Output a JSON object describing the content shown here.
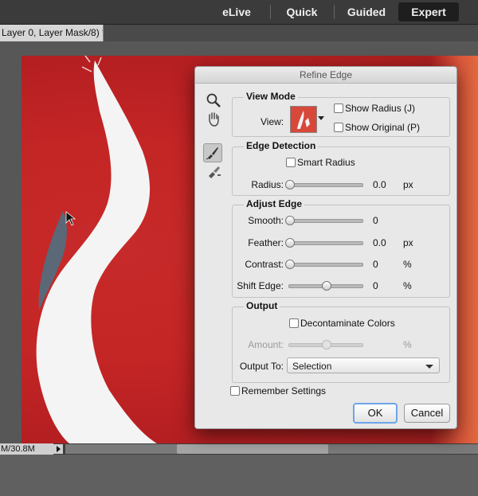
{
  "mode_tabs": [
    "eLive",
    "Quick",
    "Guided",
    "Expert"
  ],
  "active_mode": "Expert",
  "document_tab": "Layer 0, Layer Mask/8) *",
  "status_bar": {
    "doc_size": "M/30.8M"
  },
  "dialog": {
    "title": "Refine Edge",
    "view_mode": {
      "heading": "View Mode",
      "view_label": "View:",
      "show_radius": "Show Radius (J)",
      "show_original": "Show Original (P)"
    },
    "edge_detection": {
      "heading": "Edge Detection",
      "smart_radius": "Smart Radius",
      "radius_label": "Radius:",
      "radius_value": "0.0",
      "radius_unit": "px",
      "radius_level": 0
    },
    "adjust_edge": {
      "heading": "Adjust Edge",
      "rows": [
        {
          "label": "Smooth:",
          "value": "0",
          "unit": "",
          "level": 0
        },
        {
          "label": "Feather:",
          "value": "0.0",
          "unit": "px",
          "level": 0
        },
        {
          "label": "Contrast:",
          "value": "0",
          "unit": "%",
          "level": 0
        },
        {
          "label": "Shift Edge:",
          "value": "0",
          "unit": "%",
          "level": 0.5
        }
      ]
    },
    "output": {
      "heading": "Output",
      "decontaminate": "Decontaminate Colors",
      "amount_label": "Amount:",
      "amount_unit": "%",
      "output_to_label": "Output To:",
      "output_to_value": "Selection"
    },
    "remember_settings": "Remember Settings",
    "ok_label": "OK",
    "cancel_label": "Cancel"
  }
}
